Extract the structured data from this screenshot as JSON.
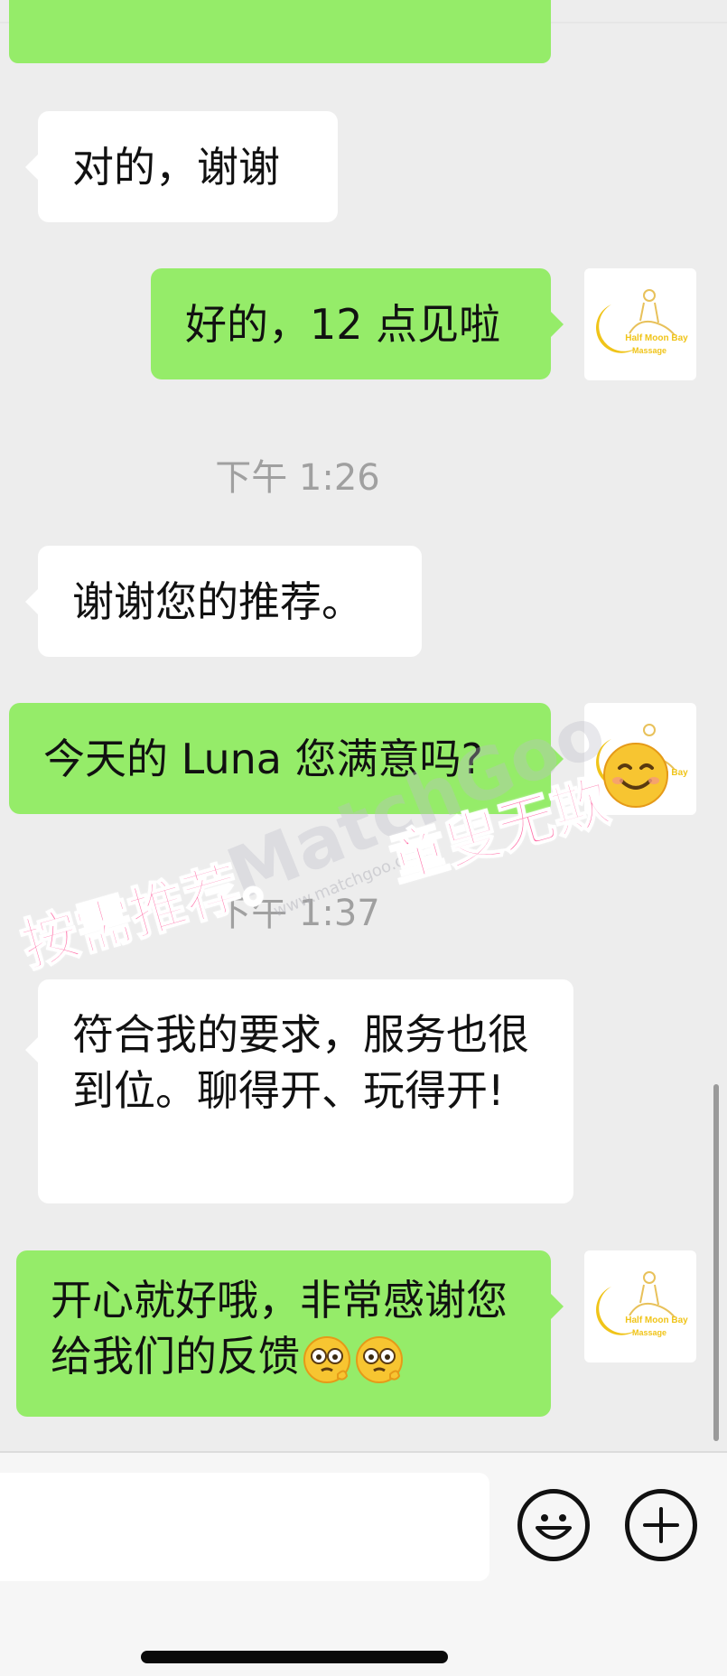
{
  "chat": {
    "messages": [
      {
        "side": "left",
        "text": "对的，谢谢"
      },
      {
        "side": "right",
        "text": "好的，12 点见啦"
      },
      {
        "type": "time",
        "text": "下午 1:26"
      },
      {
        "side": "left",
        "text": "谢谢您的推荐。"
      },
      {
        "side": "right",
        "text": "今天的 Luna 您满意吗?"
      },
      {
        "type": "time",
        "text": "下午 1:37"
      },
      {
        "side": "left",
        "text": "符合我的要求，服务也很到位。聊得开、玩得开!"
      },
      {
        "side": "right",
        "text": "开心就好哦，非常感谢您给我们的反馈"
      }
    ],
    "avatar": {
      "brand": "Half Moon Bay Massage",
      "line1": "Half Moon Bay",
      "line2": "Massage",
      "color": "#f0c419"
    }
  },
  "watermark": {
    "left_text": "按需推荐。",
    "right_text": "童叟无欺",
    "logo": "MatchGoo",
    "url": "www.matchgoo.com"
  },
  "input": {
    "placeholder": "",
    "value": ""
  },
  "icons": {
    "emoji_button": "smiley-face-icon",
    "plus_button": "plus-icon"
  },
  "colors": {
    "background": "#ededed",
    "sent_bubble": "#95ec69",
    "received_bubble": "#ffffff",
    "watermark_text": "#ff6fa8"
  }
}
